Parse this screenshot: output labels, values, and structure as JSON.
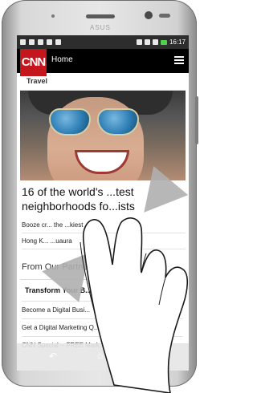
{
  "brand": "ASUS",
  "status_bar": {
    "time": "16:17"
  },
  "app_bar": {
    "logo": "CNN",
    "title": "Home",
    "menu_icon": "hamburger-menu-icon"
  },
  "section": {
    "label": "Travel"
  },
  "article": {
    "headline": "16 of the world's ...test neighborhoods fo...ists"
  },
  "related_links": [
    "Booze cr... the ...kiest",
    "Hong K... ...uaura"
  ],
  "partners": {
    "heading": "From Our Partne..."
  },
  "promo": {
    "title": "Transform Your B...",
    "links": [
      "Become a Digital Busi...",
      "Get a Digital Marketing Q...",
      "CNN Special -- FREE Mark..."
    ]
  },
  "colors": {
    "cnn_red": "#c4161c",
    "app_bar": "#000000",
    "status_bar": "#2d2d2d",
    "battery": "#4fd04f"
  },
  "icons": {
    "back": "back-icon",
    "home": "home-icon"
  }
}
